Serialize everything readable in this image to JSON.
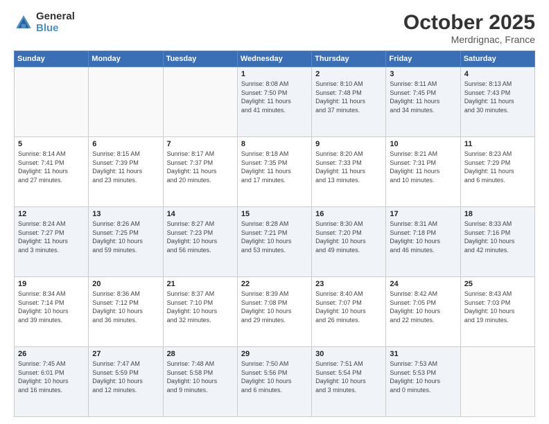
{
  "header": {
    "logo_general": "General",
    "logo_blue": "Blue",
    "month_title": "October 2025",
    "location": "Merdrignac, France"
  },
  "weekdays": [
    "Sunday",
    "Monday",
    "Tuesday",
    "Wednesday",
    "Thursday",
    "Friday",
    "Saturday"
  ],
  "rows": [
    [
      {
        "day": "",
        "info": ""
      },
      {
        "day": "",
        "info": ""
      },
      {
        "day": "",
        "info": ""
      },
      {
        "day": "1",
        "info": "Sunrise: 8:08 AM\nSunset: 7:50 PM\nDaylight: 11 hours\nand 41 minutes."
      },
      {
        "day": "2",
        "info": "Sunrise: 8:10 AM\nSunset: 7:48 PM\nDaylight: 11 hours\nand 37 minutes."
      },
      {
        "day": "3",
        "info": "Sunrise: 8:11 AM\nSunset: 7:45 PM\nDaylight: 11 hours\nand 34 minutes."
      },
      {
        "day": "4",
        "info": "Sunrise: 8:13 AM\nSunset: 7:43 PM\nDaylight: 11 hours\nand 30 minutes."
      }
    ],
    [
      {
        "day": "5",
        "info": "Sunrise: 8:14 AM\nSunset: 7:41 PM\nDaylight: 11 hours\nand 27 minutes."
      },
      {
        "day": "6",
        "info": "Sunrise: 8:15 AM\nSunset: 7:39 PM\nDaylight: 11 hours\nand 23 minutes."
      },
      {
        "day": "7",
        "info": "Sunrise: 8:17 AM\nSunset: 7:37 PM\nDaylight: 11 hours\nand 20 minutes."
      },
      {
        "day": "8",
        "info": "Sunrise: 8:18 AM\nSunset: 7:35 PM\nDaylight: 11 hours\nand 17 minutes."
      },
      {
        "day": "9",
        "info": "Sunrise: 8:20 AM\nSunset: 7:33 PM\nDaylight: 11 hours\nand 13 minutes."
      },
      {
        "day": "10",
        "info": "Sunrise: 8:21 AM\nSunset: 7:31 PM\nDaylight: 11 hours\nand 10 minutes."
      },
      {
        "day": "11",
        "info": "Sunrise: 8:23 AM\nSunset: 7:29 PM\nDaylight: 11 hours\nand 6 minutes."
      }
    ],
    [
      {
        "day": "12",
        "info": "Sunrise: 8:24 AM\nSunset: 7:27 PM\nDaylight: 11 hours\nand 3 minutes."
      },
      {
        "day": "13",
        "info": "Sunrise: 8:26 AM\nSunset: 7:25 PM\nDaylight: 10 hours\nand 59 minutes."
      },
      {
        "day": "14",
        "info": "Sunrise: 8:27 AM\nSunset: 7:23 PM\nDaylight: 10 hours\nand 56 minutes."
      },
      {
        "day": "15",
        "info": "Sunrise: 8:28 AM\nSunset: 7:21 PM\nDaylight: 10 hours\nand 53 minutes."
      },
      {
        "day": "16",
        "info": "Sunrise: 8:30 AM\nSunset: 7:20 PM\nDaylight: 10 hours\nand 49 minutes."
      },
      {
        "day": "17",
        "info": "Sunrise: 8:31 AM\nSunset: 7:18 PM\nDaylight: 10 hours\nand 46 minutes."
      },
      {
        "day": "18",
        "info": "Sunrise: 8:33 AM\nSunset: 7:16 PM\nDaylight: 10 hours\nand 42 minutes."
      }
    ],
    [
      {
        "day": "19",
        "info": "Sunrise: 8:34 AM\nSunset: 7:14 PM\nDaylight: 10 hours\nand 39 minutes."
      },
      {
        "day": "20",
        "info": "Sunrise: 8:36 AM\nSunset: 7:12 PM\nDaylight: 10 hours\nand 36 minutes."
      },
      {
        "day": "21",
        "info": "Sunrise: 8:37 AM\nSunset: 7:10 PM\nDaylight: 10 hours\nand 32 minutes."
      },
      {
        "day": "22",
        "info": "Sunrise: 8:39 AM\nSunset: 7:08 PM\nDaylight: 10 hours\nand 29 minutes."
      },
      {
        "day": "23",
        "info": "Sunrise: 8:40 AM\nSunset: 7:07 PM\nDaylight: 10 hours\nand 26 minutes."
      },
      {
        "day": "24",
        "info": "Sunrise: 8:42 AM\nSunset: 7:05 PM\nDaylight: 10 hours\nand 22 minutes."
      },
      {
        "day": "25",
        "info": "Sunrise: 8:43 AM\nSunset: 7:03 PM\nDaylight: 10 hours\nand 19 minutes."
      }
    ],
    [
      {
        "day": "26",
        "info": "Sunrise: 7:45 AM\nSunset: 6:01 PM\nDaylight: 10 hours\nand 16 minutes."
      },
      {
        "day": "27",
        "info": "Sunrise: 7:47 AM\nSunset: 5:59 PM\nDaylight: 10 hours\nand 12 minutes."
      },
      {
        "day": "28",
        "info": "Sunrise: 7:48 AM\nSunset: 5:58 PM\nDaylight: 10 hours\nand 9 minutes."
      },
      {
        "day": "29",
        "info": "Sunrise: 7:50 AM\nSunset: 5:56 PM\nDaylight: 10 hours\nand 6 minutes."
      },
      {
        "day": "30",
        "info": "Sunrise: 7:51 AM\nSunset: 5:54 PM\nDaylight: 10 hours\nand 3 minutes."
      },
      {
        "day": "31",
        "info": "Sunrise: 7:53 AM\nSunset: 5:53 PM\nDaylight: 10 hours\nand 0 minutes."
      },
      {
        "day": "",
        "info": ""
      }
    ]
  ]
}
